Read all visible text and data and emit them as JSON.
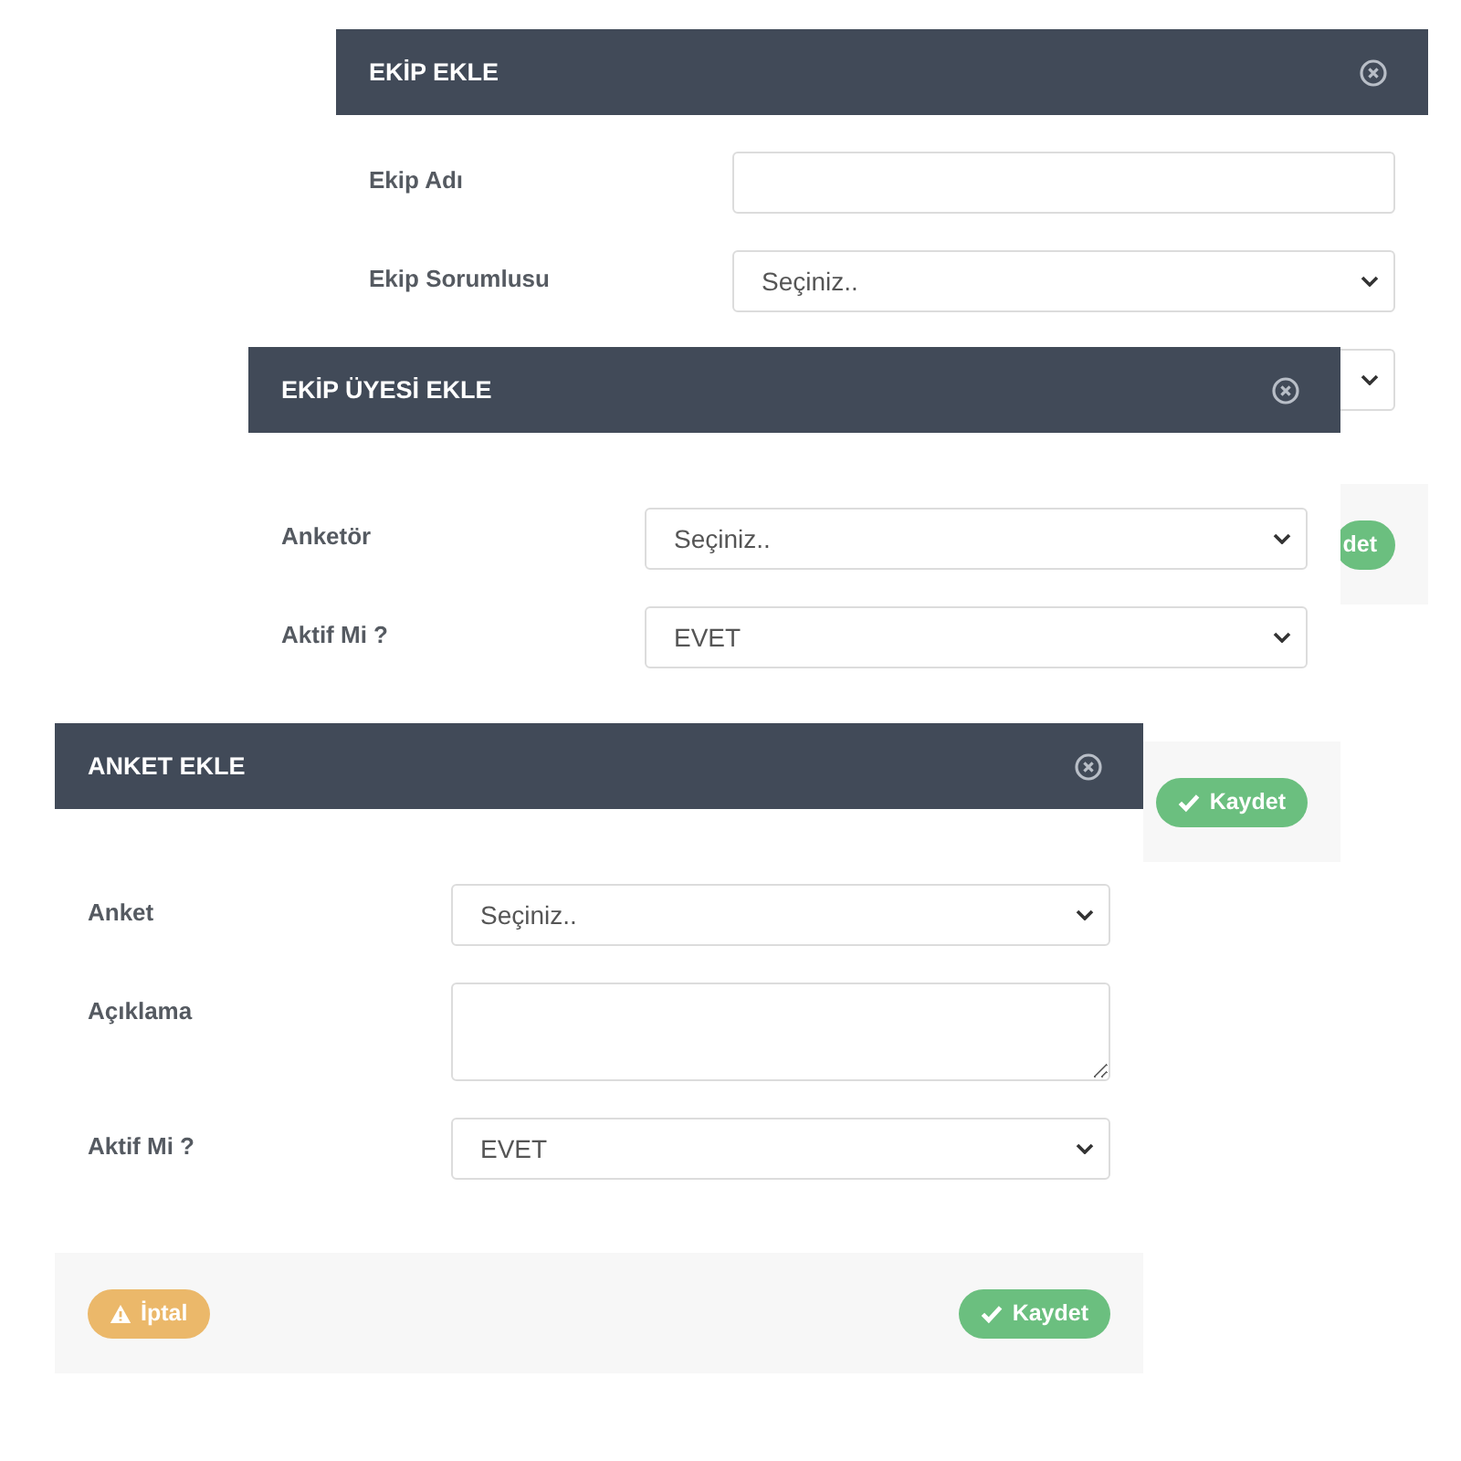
{
  "windows": [
    {
      "title": "EKİP EKLE",
      "fields": [
        {
          "label": "Ekip Adı",
          "kind": "text"
        },
        {
          "label": "Ekip Sorumlusu",
          "kind": "select",
          "value": "Seçiniz.."
        },
        {
          "kind": "select"
        }
      ],
      "buttons": [
        {
          "label": "det",
          "kind": "save"
        }
      ]
    },
    {
      "title": "EKİP ÜYESİ EKLE",
      "fields": [
        {
          "label": "Anketör",
          "kind": "select",
          "value": "Seçiniz.."
        },
        {
          "label": "Aktif Mi ?",
          "kind": "select",
          "value": "EVET"
        }
      ],
      "buttons": [
        {
          "label": "Kaydet",
          "kind": "save"
        }
      ]
    },
    {
      "title": "ANKET EKLE",
      "fields": [
        {
          "label": "Anket",
          "kind": "select",
          "value": "Seçiniz.."
        },
        {
          "label": "Açıklama",
          "kind": "textarea"
        },
        {
          "label": "Aktif Mi ?",
          "kind": "select",
          "value": "EVET"
        }
      ],
      "buttons": [
        {
          "label": "İptal",
          "kind": "cancel"
        },
        {
          "label": "Kaydet",
          "kind": "save"
        }
      ]
    }
  ]
}
